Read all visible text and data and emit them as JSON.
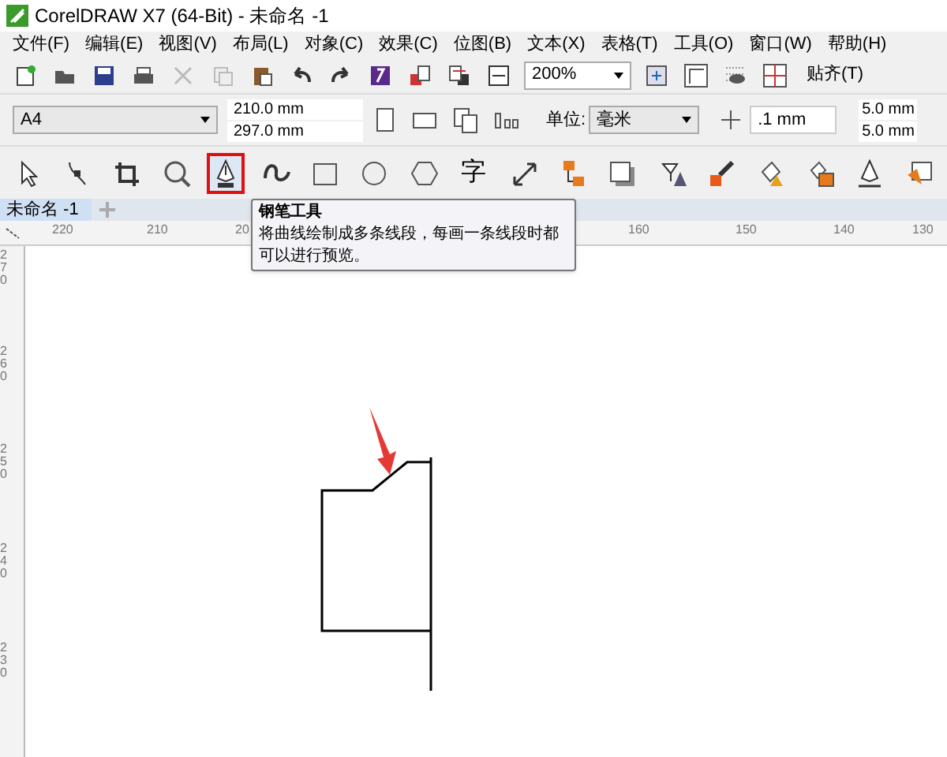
{
  "window": {
    "title": "CorelDRAW X7 (64-Bit) - 未命名 -1"
  },
  "menu": [
    "文件(F)",
    "编辑(E)",
    "视图(V)",
    "布局(L)",
    "对象(C)",
    "效果(C)",
    "位图(B)",
    "文本(X)",
    "表格(T)",
    "工具(O)",
    "窗口(W)",
    "帮助(H)"
  ],
  "standard_toolbar": {
    "zoom": "200%",
    "snap": "贴齐(T)"
  },
  "property_bar": {
    "page_size": "A4",
    "width": "210.0 mm",
    "height": "297.0 mm",
    "units_label": "单位:",
    "units": "毫米",
    "nudge": ".1 mm",
    "duplicate_x": "5.0 mm",
    "duplicate_y": "5.0 mm"
  },
  "toolbox": [
    {
      "kind": "pick",
      "selected": false
    },
    {
      "kind": "shape",
      "selected": false
    },
    {
      "kind": "crop",
      "selected": false
    },
    {
      "kind": "zoom",
      "selected": false
    },
    {
      "kind": "pen",
      "selected": true
    },
    {
      "kind": "artistic",
      "selected": false
    },
    {
      "kind": "rect",
      "selected": false
    },
    {
      "kind": "ellipse",
      "selected": false
    },
    {
      "kind": "polygon",
      "selected": false
    },
    {
      "kind": "text",
      "label": "字",
      "selected": false
    },
    {
      "kind": "dimension",
      "selected": false
    },
    {
      "kind": "connector",
      "selected": false
    },
    {
      "kind": "shadow",
      "selected": false
    },
    {
      "kind": "transparency",
      "selected": false
    },
    {
      "kind": "eyedropper",
      "selected": false
    },
    {
      "kind": "fill",
      "selected": false
    },
    {
      "kind": "smartfill",
      "selected": false
    },
    {
      "kind": "outline",
      "selected": false
    },
    {
      "kind": "window",
      "selected": false
    }
  ],
  "document_tabs": [
    {
      "label": "未命名 -1",
      "selected": true
    }
  ],
  "tooltip": {
    "title": "钢笔工具",
    "text": "将曲线绘制成多条线段，每画一条线段时都可以进行预览。"
  },
  "horizontal_ruler": [
    "220",
    "210",
    "20",
    "160",
    "150",
    "140",
    "130"
  ],
  "vertical_ruler": [
    "270",
    "260",
    "250",
    "240",
    "230"
  ]
}
